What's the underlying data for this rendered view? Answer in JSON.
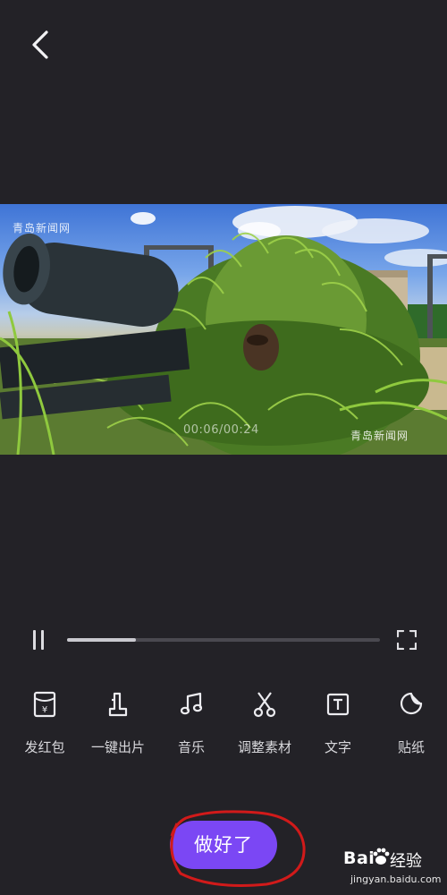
{
  "nav": {
    "back_icon": "chevron-left-icon"
  },
  "video": {
    "watermark_top": "青岛新闻网",
    "watermark_bottom": "青岛新闻网",
    "timecode": "00:06/00:24"
  },
  "playback": {
    "pause_icon": "pause-icon",
    "fullscreen_icon": "fullscreen-icon",
    "progress": 0.22
  },
  "tools": [
    {
      "label": "发红包",
      "icon": "red-envelope-icon"
    },
    {
      "label": "一键出片",
      "icon": "one-click-film-icon"
    },
    {
      "label": "音乐",
      "icon": "music-note-icon"
    },
    {
      "label": "调整素材",
      "icon": "scissors-icon"
    },
    {
      "label": "文字",
      "icon": "text-icon"
    },
    {
      "label": "贴纸",
      "icon": "sticker-icon"
    }
  ],
  "done_label": "做好了",
  "watermark": {
    "brand": "Bai",
    "jingyan": "经验",
    "url": "jingyan.baidu.com"
  },
  "colors": {
    "background": "#232227",
    "accent": "#7b47f4",
    "annotation": "#d11a1a"
  }
}
